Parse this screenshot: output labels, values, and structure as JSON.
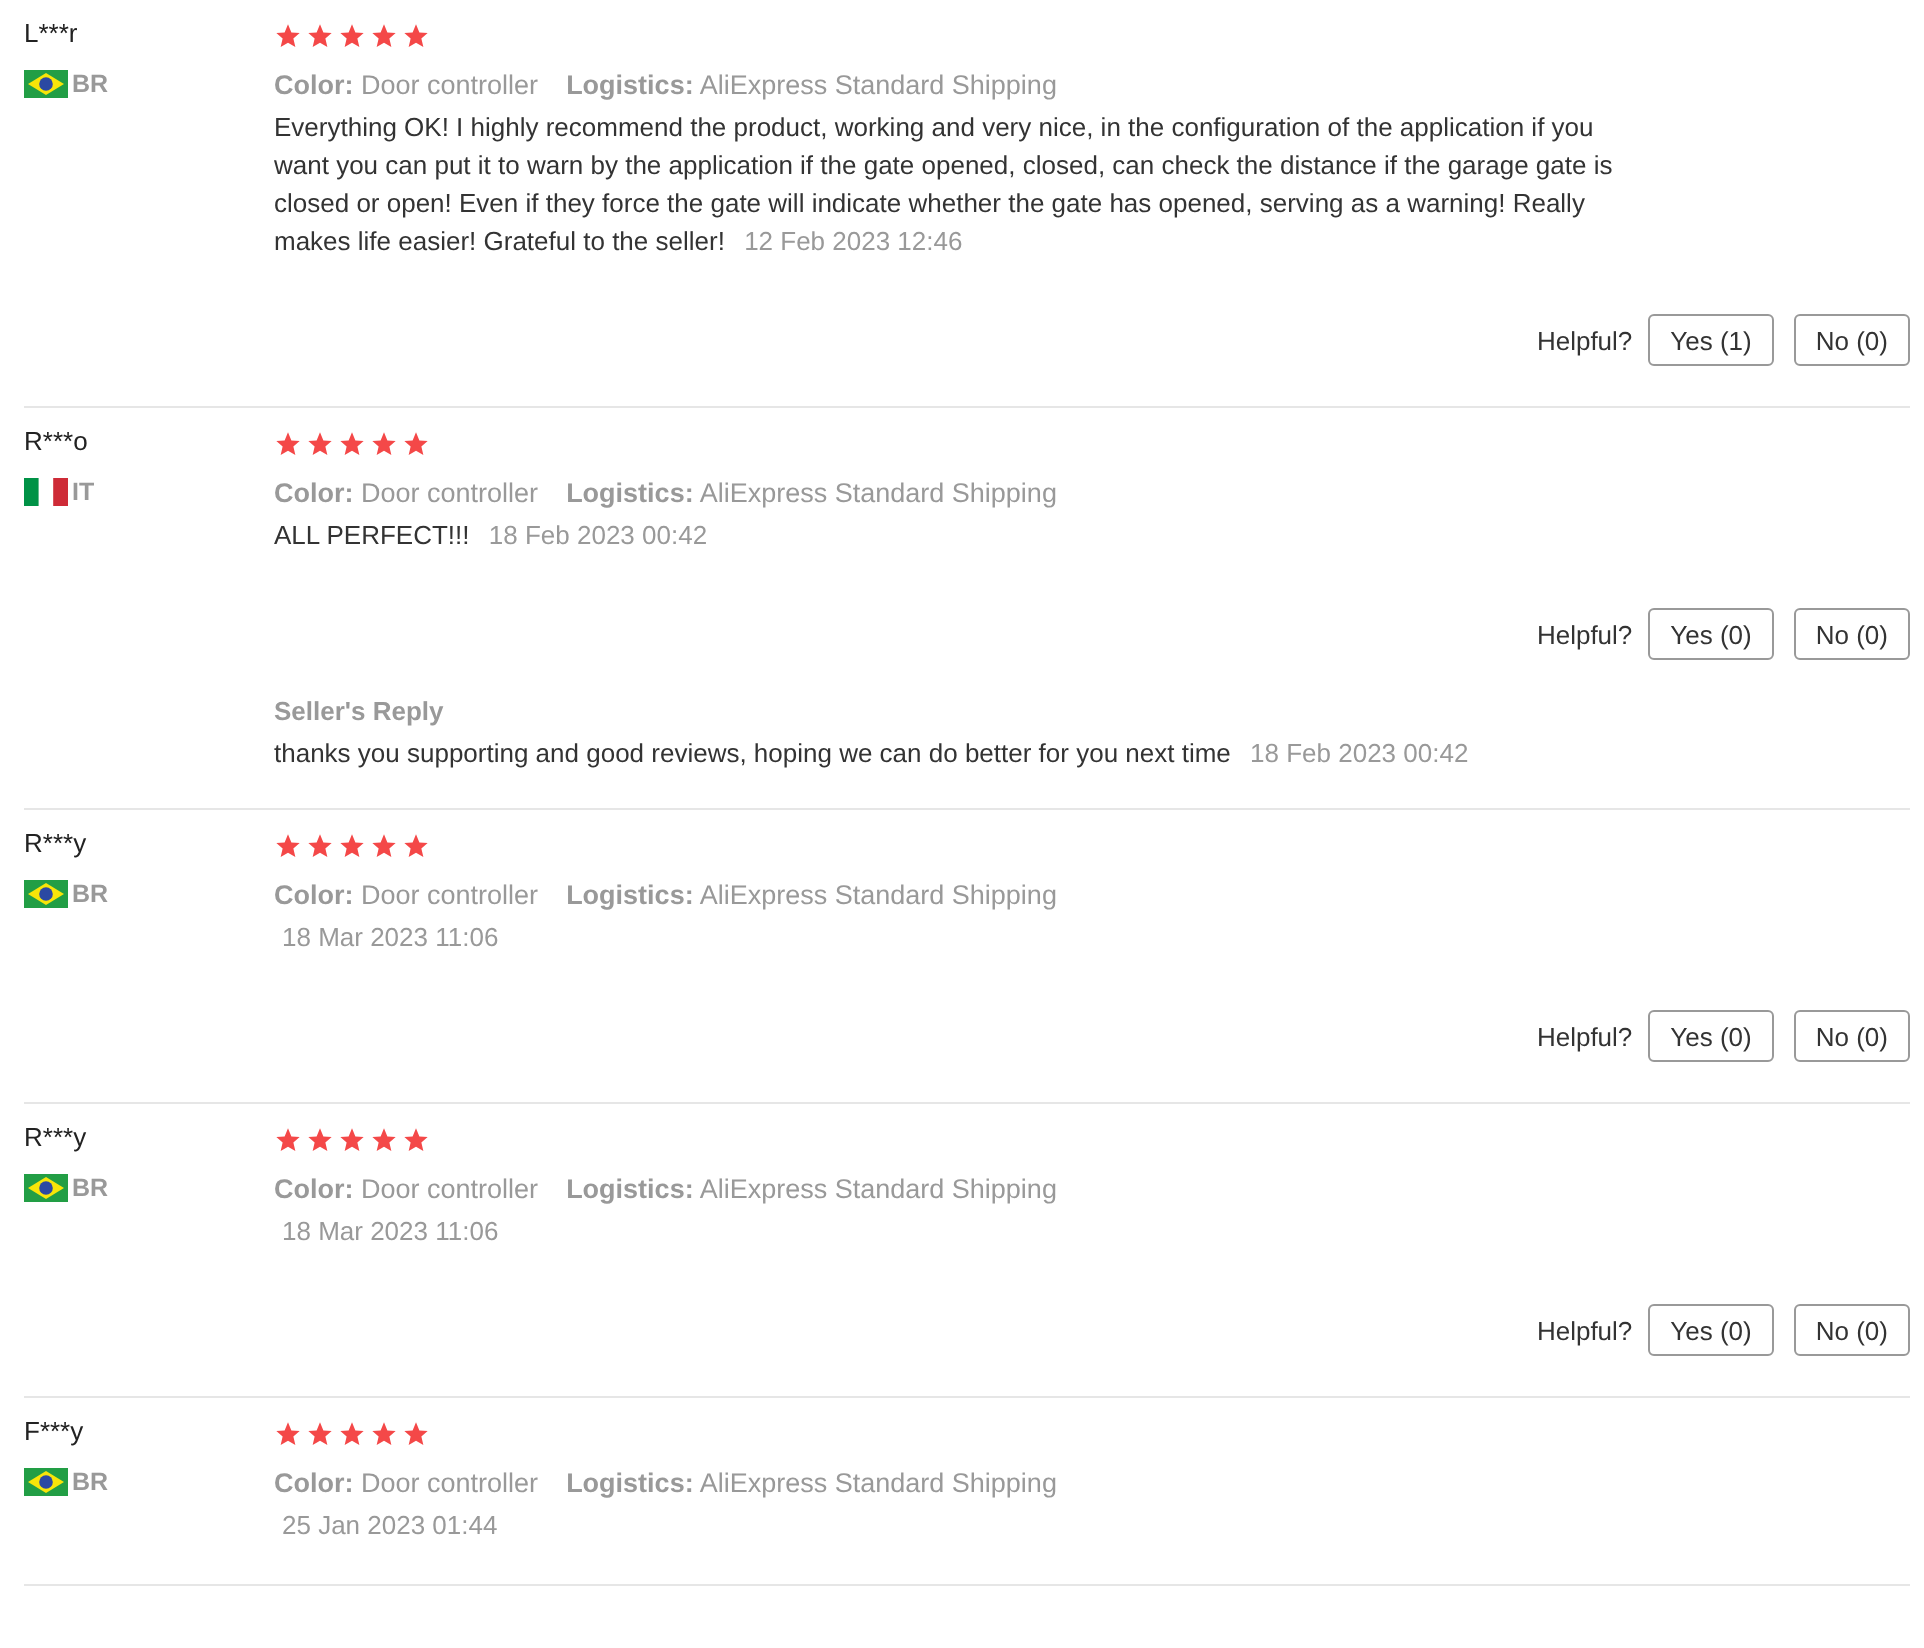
{
  "reviews": [
    {
      "user": "L***r",
      "flag": {
        "kind": "br"
      },
      "country": "BR",
      "stars": 5,
      "variant_label": "Color:",
      "variant": "Door controller",
      "logistics_label": "Logistics:",
      "logistics": "AliExpress Standard Shipping",
      "text": "Everything OK! I highly recommend the product, working and very nice, in the configuration of the application if you want you can put it to warn by the application if the gate opened, closed, can check the distance if the garage gate is closed or open! Even if they force the gate will indicate whether the gate has opened, serving as a warning! Really makes life easier! Grateful to the seller!",
      "date": "12 Feb 2023 12:46",
      "helpful_label": "Helpful?",
      "yes": "Yes (1)",
      "no": "No (0)"
    },
    {
      "user": "R***o",
      "flag": {
        "kind": "it"
      },
      "country": "IT",
      "stars": 5,
      "variant_label": "Color:",
      "variant": "Door controller",
      "logistics_label": "Logistics:",
      "logistics": "AliExpress Standard Shipping",
      "text": "ALL PERFECT!!!",
      "date": "18 Feb 2023 00:42",
      "helpful_label": "Helpful?",
      "yes": "Yes (0)",
      "no": "No (0)",
      "reply": {
        "title": "Seller's Reply",
        "text": "thanks you supporting and good reviews, hoping we can do better for you next time",
        "date": "18 Feb 2023 00:42"
      }
    },
    {
      "user": "R***y",
      "flag": {
        "kind": "br"
      },
      "country": "BR",
      "stars": 5,
      "variant_label": "Color:",
      "variant": "Door controller",
      "logistics_label": "Logistics:",
      "logistics": "AliExpress Standard Shipping",
      "date": "18 Mar 2023 11:06",
      "helpful_label": "Helpful?",
      "yes": "Yes (0)",
      "no": "No (0)"
    },
    {
      "user": "R***y",
      "flag": {
        "kind": "br"
      },
      "country": "BR",
      "stars": 5,
      "variant_label": "Color:",
      "variant": "Door controller",
      "logistics_label": "Logistics:",
      "logistics": "AliExpress Standard Shipping",
      "date": "18 Mar 2023 11:06",
      "helpful_label": "Helpful?",
      "yes": "Yes (0)",
      "no": "No (0)"
    },
    {
      "user": "F***y",
      "flag": {
        "kind": "br"
      },
      "country": "BR",
      "stars": 5,
      "variant_label": "Color:",
      "variant": "Door controller",
      "logistics_label": "Logistics:",
      "logistics": "AliExpress Standard Shipping",
      "date": "25 Jan 2023 01:44"
    }
  ]
}
